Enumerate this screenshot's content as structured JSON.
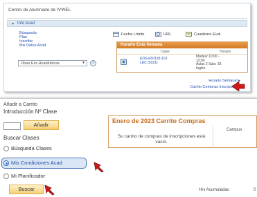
{
  "top_panel": {
    "title": "Centro de Alumnado de IVWEL",
    "section_label": "Info Acad",
    "links": [
      "Búsqueda",
      "Plan",
      "Inscribir",
      "Mis Datos Acad"
    ],
    "other_select": "Otras Enc.Académicas",
    "toolbar": {
      "search": "Fecha Límite",
      "url": "URL",
      "degree": "Cuaderno Eval"
    },
    "schedule": {
      "title": "Horario Esta Semana",
      "col_class": "Clase",
      "col_time": "Horario",
      "class_text": "EDG E50193-102\nLEC (2021)",
      "time_text": "Martes/ 10:00 -\n12:00\nAulas 2 Sala: 33\nInglés"
    },
    "weekly_link": "Horario Semanal",
    "cart_link": "Carrito Compras Inscripción"
  },
  "bottom_panel": {
    "add_heading": "Añadir a Carrito",
    "intro_label": "Introducción Nº Clase",
    "class_input_value": "",
    "add_button": "Añadir",
    "search_heading": "Buscar Clases",
    "radios": [
      {
        "label": "Búsqueda Clases",
        "checked": false
      },
      {
        "label": "Mis Condiciones Acad",
        "checked": true
      },
      {
        "label": "Mi Planificador",
        "checked": false
      }
    ],
    "search_button": "Buscar",
    "cart": {
      "title": "Enero de 2023 Carrito Compras",
      "campus_header": "Campus",
      "empty_message": "Su carrito de compras de inscripciones está vacío."
    },
    "hrs_label": "Hrs Acumuladas",
    "hrs_value": "0"
  },
  "colors": {
    "link": "#2250b3",
    "accent_orange": "#d27a24",
    "button_fill": "#f5cf75",
    "cursor_red": "#d01a1a"
  }
}
